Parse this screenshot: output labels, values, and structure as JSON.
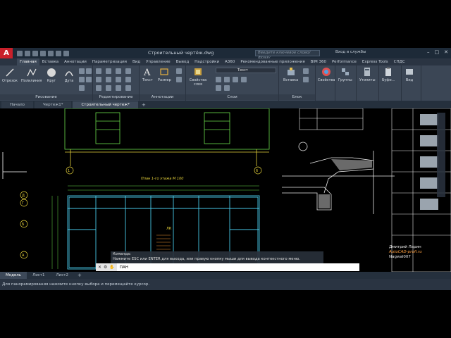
{
  "window": {
    "title": "Строительный чертёж.dwg",
    "search_placeholder": "Введите ключевое слово/фразу",
    "signin": "Вход в службы",
    "app_letter": "A"
  },
  "ribbon_tabs": [
    "Главная",
    "Вставка",
    "Аннотации",
    "Параметризация",
    "Вид",
    "Управление",
    "Вывод",
    "Надстройки",
    "A360",
    "Рекомендованные приложения",
    "BIM 360",
    "Performance",
    "Express Tools",
    "СПДС"
  ],
  "ribbon": {
    "draw": {
      "title": "Рисование",
      "tools": [
        "Отрезок",
        "Полилиния",
        "Круг",
        "Дуга"
      ]
    },
    "modify": {
      "title": "Редактирование"
    },
    "annotation": {
      "title": "Аннотации",
      "tools": [
        "Текст",
        "Размер"
      ]
    },
    "layers": {
      "title": "Слои",
      "tool": "Свойства слоя",
      "layer_name": "Текст"
    },
    "block": {
      "title": "Блок",
      "tool": "Вставка"
    },
    "properties": {
      "tool": "Свойства"
    },
    "groups": {
      "tool": "Группы"
    },
    "utilities": {
      "tool": "Утилиты"
    },
    "clipboard": {
      "tool": "Буфе..."
    },
    "view": {
      "tool": "Вид"
    }
  },
  "file_tabs": [
    "Начало",
    "Чертеж1*",
    "Строительный чертеж*"
  ],
  "drawing": {
    "plan_title": "План 1-го этажа М 100",
    "axis_labels": [
      "А",
      "Б",
      "Г",
      "Д",
      "1",
      "6"
    ],
    "room_label": "ЛК"
  },
  "command": {
    "history_label": "Команда:",
    "history_text": "Нажмите ESC или ENTER для выхода, или правую кнопку мыши для вывода контекстного меню.",
    "input": "ПАН"
  },
  "watermark": {
    "author": "Дмитрий Ларин",
    "site": "AutoCAD-profi.ru",
    "sub": "Nagwal007"
  },
  "layout_tabs": [
    "Модель",
    "Лист1",
    "Лист2"
  ],
  "status": "Для панорамирования нажмите кнопку выбора и перемещайте курсор.",
  "colors": {
    "accent": "#c8202a",
    "ribbon": "#3b4655",
    "drawing_green": "#6bdc4a",
    "drawing_cyan": "#49c8e8",
    "drawing_yellow": "#e6d23a"
  }
}
